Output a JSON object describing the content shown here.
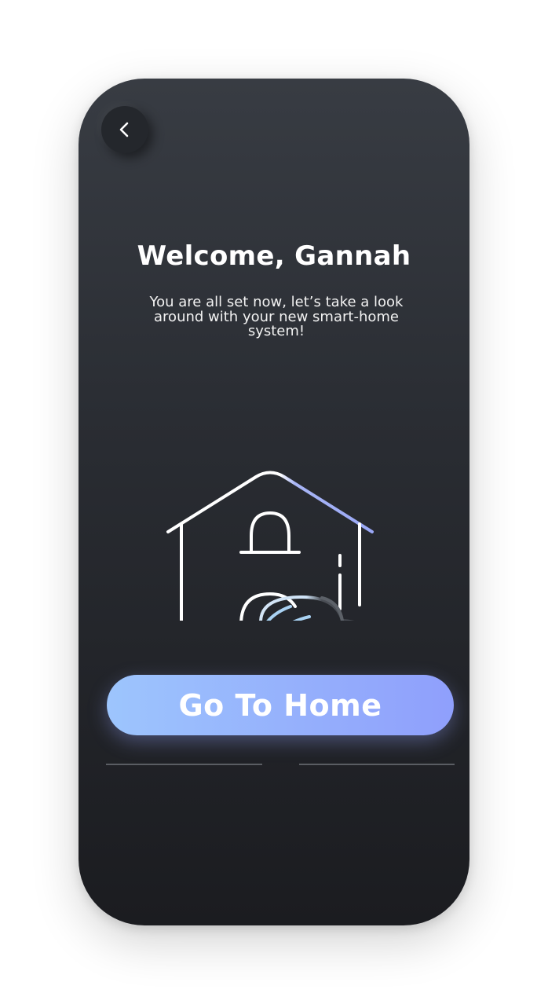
{
  "screen": {
    "title": "Welcome, Gannah",
    "subtitle": "You are all set now, let’s take a look around with your new smart-home system!",
    "back_icon": "chevron-left-icon",
    "illustration_icon": "smart-home-cloud-icon"
  },
  "cta": {
    "label": "Go To Home"
  },
  "colors": {
    "accent_start": "#9dc5fd",
    "accent_end": "#8f9ffc",
    "background_top": "#383c43",
    "background_bottom": "#1b1c20",
    "text": "#ffffff"
  }
}
